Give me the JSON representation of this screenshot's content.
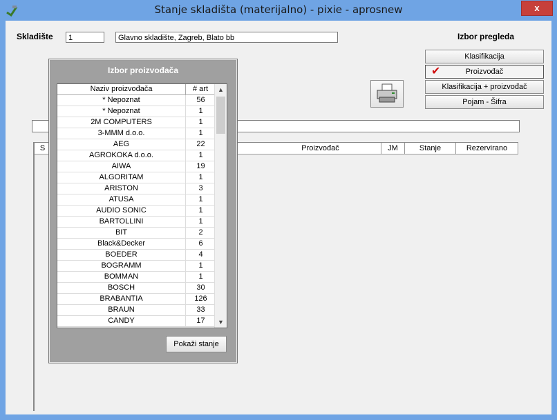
{
  "window": {
    "title": "Stanje skladišta (materijalno) - pixie - aprosnew",
    "close_label": "x"
  },
  "header": {
    "skladiste_label": "Skladište",
    "skladiste_code": "1",
    "skladiste_name": "Glavno skladište, Zagreb, Blato bb",
    "izbor_label": "Izbor pregleda"
  },
  "buttons": {
    "klasifikacija": "Klasifikacija",
    "proizvodac": "Proizvođač",
    "klas_proizv": "Klasifikacija + proizvođač",
    "pojam_sifra": "Pojam - Šifra"
  },
  "grid": {
    "columns": [
      "S",
      "Proizvođač",
      "JM",
      "Stanje",
      "Rezervirano"
    ]
  },
  "dialog": {
    "title": "Izbor proizvođača",
    "col_name": "Naziv proizvođača",
    "col_count": "# art",
    "rows": [
      {
        "name": "* Nepoznat",
        "count": "56"
      },
      {
        "name": "* Nepoznat",
        "count": "1"
      },
      {
        "name": "2M COMPUTERS",
        "count": "1"
      },
      {
        "name": "3-MMM d.o.o.",
        "count": "1"
      },
      {
        "name": "AEG",
        "count": "22"
      },
      {
        "name": "AGROKOKA d.o.o.",
        "count": "1"
      },
      {
        "name": "AIWA",
        "count": "19"
      },
      {
        "name": "ALGORITAM",
        "count": "1"
      },
      {
        "name": "ARISTON",
        "count": "3"
      },
      {
        "name": "ATUSA",
        "count": "1"
      },
      {
        "name": "AUDIO SONIC",
        "count": "1"
      },
      {
        "name": "BARTOLLINI",
        "count": "1"
      },
      {
        "name": "BIT",
        "count": "2"
      },
      {
        "name": "Black&Decker",
        "count": "6"
      },
      {
        "name": "BOEDER",
        "count": "4"
      },
      {
        "name": "BOGRAMM",
        "count": "1"
      },
      {
        "name": "BOMMAN",
        "count": "1"
      },
      {
        "name": "BOSCH",
        "count": "30"
      },
      {
        "name": "BRABANTIA",
        "count": "126"
      },
      {
        "name": "BRAUN",
        "count": "33"
      },
      {
        "name": "CANDY",
        "count": "17"
      }
    ],
    "show_button": "Pokaži stanje"
  }
}
